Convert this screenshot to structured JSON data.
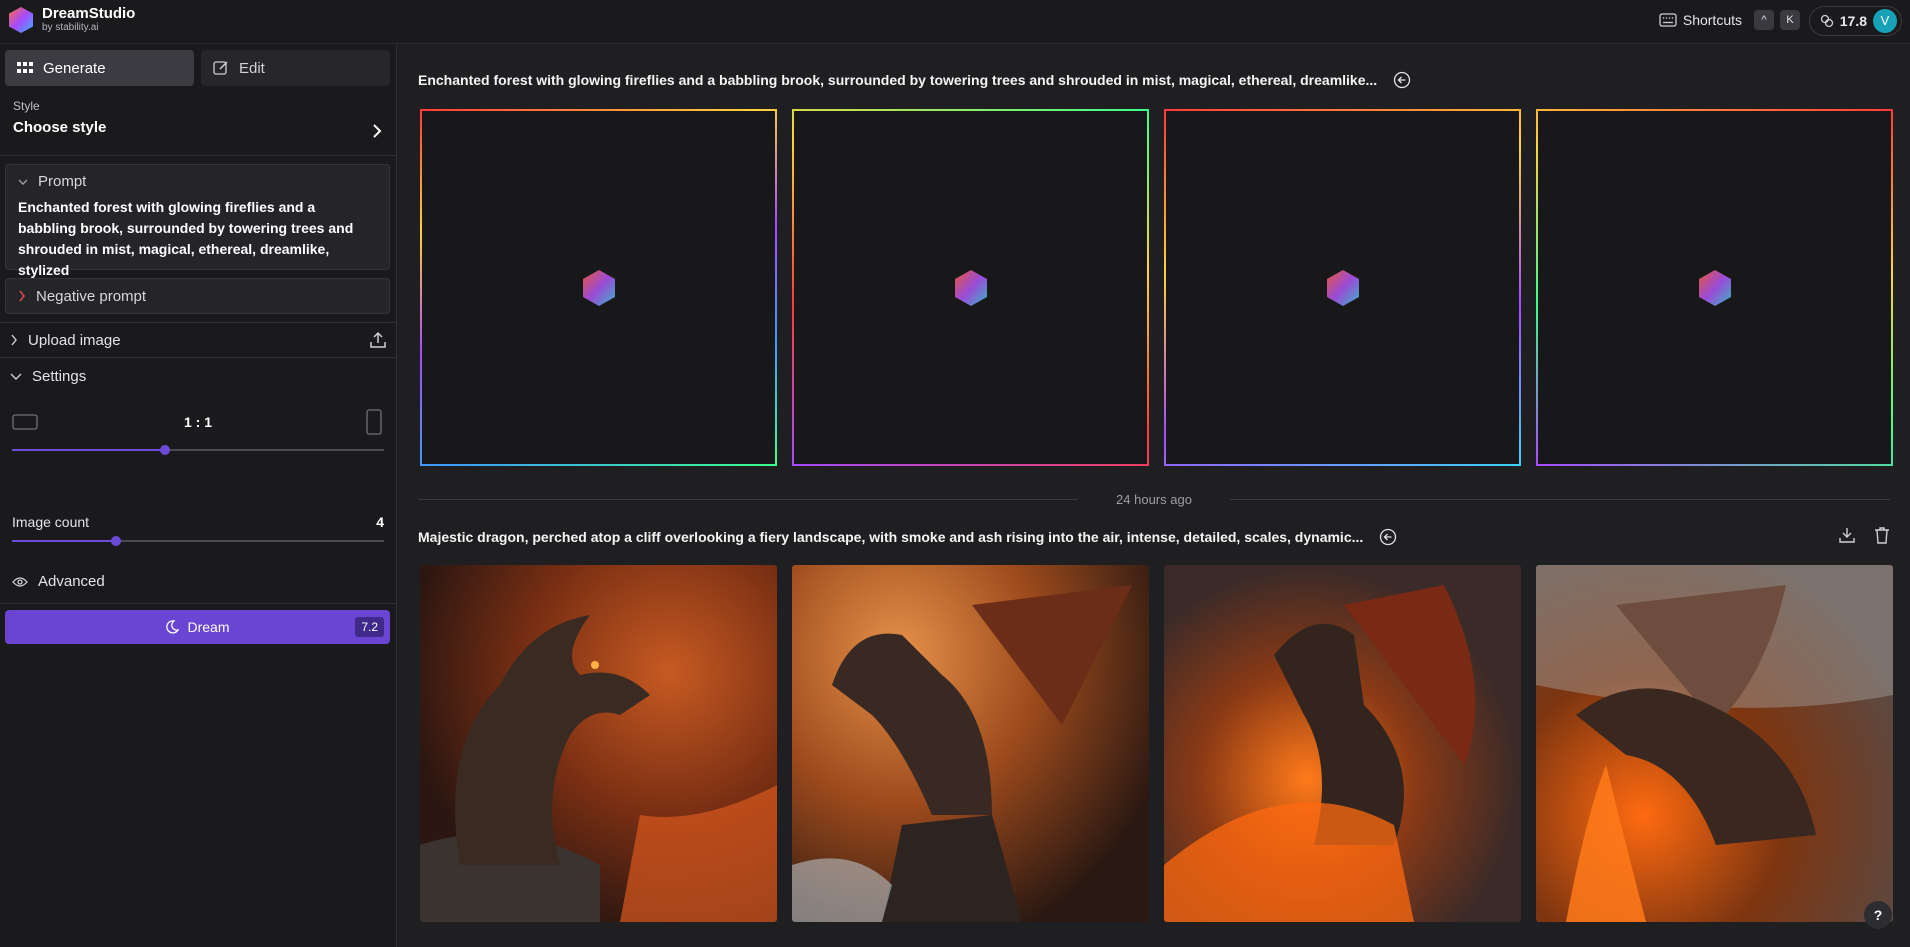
{
  "app": {
    "title": "DreamStudio",
    "subtitle": "by stability.ai",
    "shortcuts_label": "Shortcuts",
    "shortcut_keys": [
      "^",
      "K"
    ],
    "credits": "17.8",
    "avatar_initial": "V",
    "accent": "#6a45d4"
  },
  "sidebar": {
    "tabs": [
      {
        "label": "Generate",
        "icon": "grid-icon",
        "active": true
      },
      {
        "label": "Edit",
        "icon": "edit-icon",
        "active": false
      }
    ],
    "style": {
      "label": "Style",
      "value": "Choose style"
    },
    "prompt": {
      "label": "Prompt",
      "text": "Enchanted forest with glowing fireflies and a babbling brook, surrounded by towering trees and shrouded in mist, magical, ethereal, dreamlike, stylized"
    },
    "negative_prompt": {
      "label": "Negative prompt"
    },
    "upload_image": {
      "label": "Upload image"
    },
    "settings": {
      "label": "Settings",
      "aspect_ratio": "1 : 1",
      "aspect_slider_fraction": 0.41,
      "image_count_label": "Image count",
      "image_count": "4",
      "image_count_fraction": 0.28
    },
    "advanced": {
      "label": "Advanced"
    },
    "dream": {
      "label": "Dream",
      "cost": "7.2"
    }
  },
  "main": {
    "generations": [
      {
        "title": "Enchanted forest with glowing fireflies and a babbling brook, surrounded by towering trees and shrouded in mist, magical, ethereal, dreamlike...",
        "status": "loading",
        "image_count": 4
      },
      {
        "title": "Majestic dragon, perched atop a cliff overlooking a fiery landscape, with smoke and ash rising into the air, intense, detailed, scales, dynamic...",
        "status": "complete",
        "image_count": 4
      }
    ],
    "divider_text": "24 hours ago",
    "help_label": "?"
  }
}
